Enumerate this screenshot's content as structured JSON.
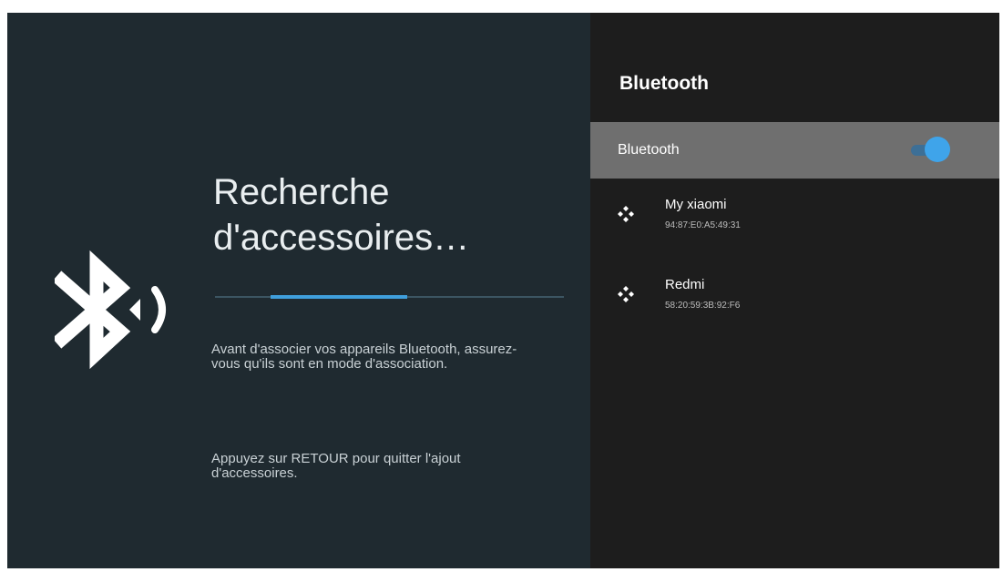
{
  "left_panel": {
    "heading_line1": "Recherche",
    "heading_line2": "d'accessoires…",
    "scan_progress_fraction": 0.39,
    "description": "Avant d'associer vos appareils Bluetooth, assurez-vous qu'ils sont en mode d'association.",
    "back_hint": "Appuyez sur RETOUR pour quitter l'ajout d'accessoires.",
    "icon": "bluetooth-searching-icon"
  },
  "right_panel": {
    "title": "Bluetooth",
    "toggle": {
      "label": "Bluetooth",
      "enabled": true
    },
    "devices": [
      {
        "name": "My xiaomi",
        "address": "94:87:E0:A5:49:31",
        "icon": "gamepad-icon"
      },
      {
        "name": "Redmi",
        "address": "58:20:59:3B:92:F6",
        "icon": "gamepad-icon"
      }
    ]
  },
  "colors": {
    "left_background": "#1f2a30",
    "right_background": "#1d1d1d",
    "selected_row": "#6f6f6f",
    "accent": "#3fa4ea"
  }
}
